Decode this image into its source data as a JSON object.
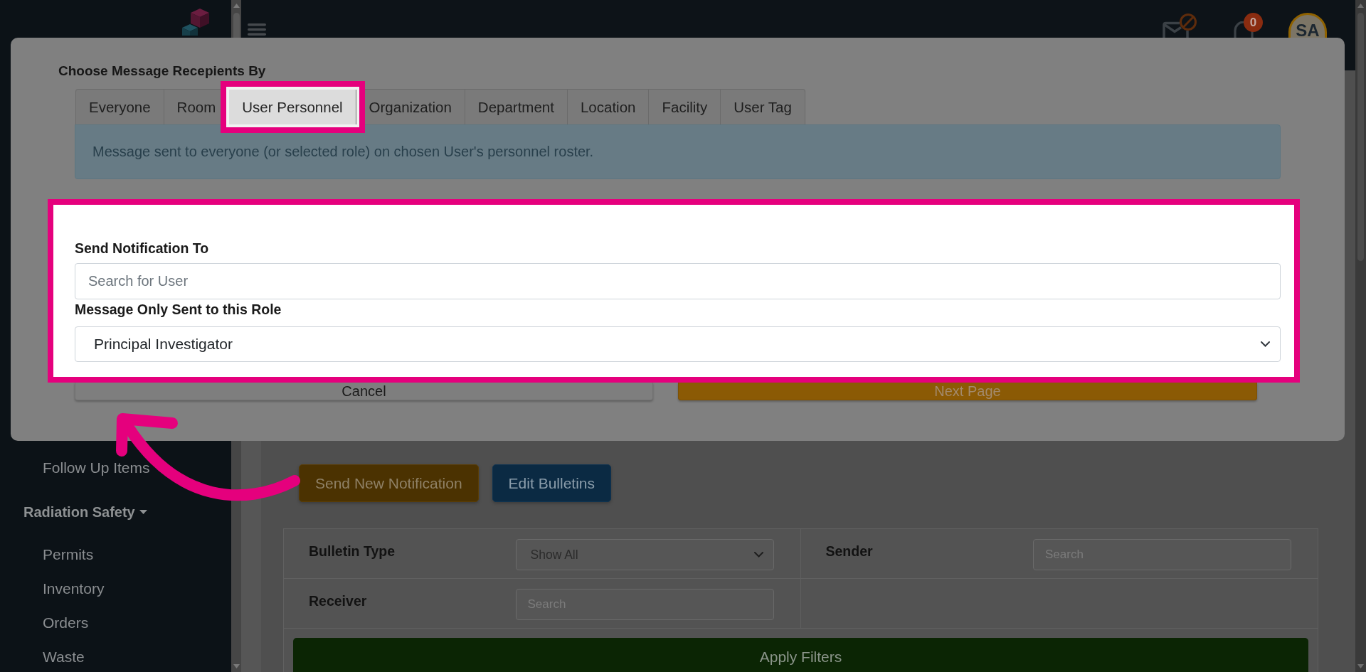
{
  "header": {
    "notification_count": "0",
    "avatar_initials": "SA"
  },
  "modal": {
    "title": "Choose Message Recepients By",
    "tabs": [
      {
        "label": "Everyone",
        "selected": false,
        "highlighted": false
      },
      {
        "label": "Room",
        "selected": false,
        "highlighted": false
      },
      {
        "label": "User Personnel",
        "selected": true,
        "highlighted": true
      },
      {
        "label": "Organization",
        "selected": false,
        "highlighted": false
      },
      {
        "label": "Department",
        "selected": false,
        "highlighted": false
      },
      {
        "label": "Location",
        "selected": false,
        "highlighted": false
      },
      {
        "label": "Facility",
        "selected": false,
        "highlighted": false
      },
      {
        "label": "User Tag",
        "selected": false,
        "highlighted": false
      }
    ],
    "info": "Message sent to everyone (or selected role) on chosen User's personnel roster.",
    "highlighted": true,
    "fields": [
      {
        "kind": "search",
        "label": "Send Notification To",
        "placeholder": "Search for User"
      },
      {
        "kind": "select",
        "label": "Message Only Sent to this Role",
        "value": "Principal Investigator"
      }
    ],
    "buttons": [
      {
        "kind": "secondary",
        "label": "Cancel"
      },
      {
        "kind": "warning",
        "label": "Next Page"
      }
    ]
  },
  "sidebar": {
    "items": [
      {
        "kind": "link",
        "label": "Follow Up Items"
      },
      {
        "kind": "section",
        "label": "Radiation Safety",
        "expanded": true,
        "children": [
          {
            "label": "Permits"
          },
          {
            "label": "Inventory"
          },
          {
            "label": "Orders"
          },
          {
            "label": "Waste"
          }
        ]
      }
    ]
  },
  "page": {
    "actions": [
      {
        "kind": "warning",
        "label": "Send New Notification"
      },
      {
        "kind": "primary",
        "label": "Edit Bulletins"
      }
    ],
    "filters": [
      {
        "kind": "select",
        "label": "Bulletin Type",
        "value": "Show All"
      },
      {
        "kind": "text",
        "label": "Sender",
        "placeholder": "Search"
      },
      {
        "kind": "text",
        "label": "Receiver",
        "placeholder": "Search"
      }
    ],
    "apply_button": "Apply Filters"
  }
}
